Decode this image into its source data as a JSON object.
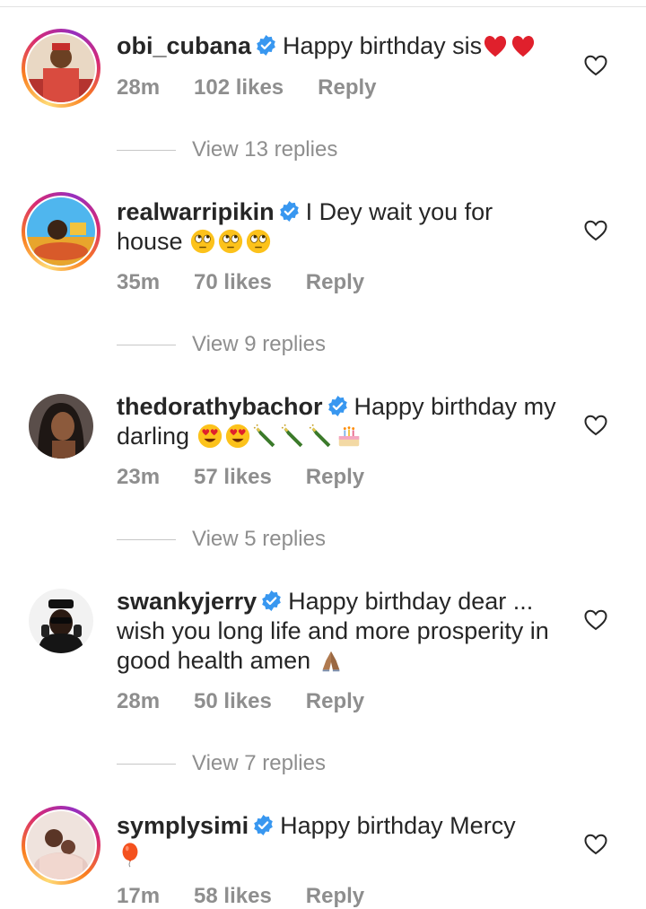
{
  "colors": {
    "text": "#262626",
    "muted": "#8e8e8e",
    "verified": "#3897f0",
    "background": "#ffffff"
  },
  "comments": [
    {
      "username": "obi_cubana",
      "verified": true,
      "text": "Happy birthday sis",
      "emojis": [
        "red-heart",
        "red-heart"
      ],
      "time": "28m",
      "likes": "102 likes",
      "reply_label": "Reply",
      "view_replies": "View 13 replies"
    },
    {
      "username": "realwarripikin",
      "verified": true,
      "text": "I Dey wait you for house",
      "emojis": [
        "rolling-eyes",
        "rolling-eyes",
        "rolling-eyes"
      ],
      "time": "35m",
      "likes": "70 likes",
      "reply_label": "Reply",
      "view_replies": "View 9 replies"
    },
    {
      "username": "thedorathybachor",
      "verified": true,
      "text": "Happy birthday my darling",
      "emojis": [
        "heart-eyes",
        "heart-eyes",
        "champagne",
        "champagne",
        "champagne",
        "birthday-cake"
      ],
      "time": "23m",
      "likes": "57 likes",
      "reply_label": "Reply",
      "view_replies": "View 5 replies"
    },
    {
      "username": "swankyjerry",
      "verified": true,
      "text": "Happy birthday dear ... wish you long life and more prosperity in good health amen",
      "emojis": [
        "folded-hands"
      ],
      "time": "28m",
      "likes": "50 likes",
      "reply_label": "Reply",
      "view_replies": "View 7 replies"
    },
    {
      "username": "symplysimi",
      "verified": true,
      "text": "Happy birthday Mercy",
      "emojis": [
        "balloon"
      ],
      "time": "17m",
      "likes": "58 likes",
      "reply_label": "Reply"
    }
  ]
}
